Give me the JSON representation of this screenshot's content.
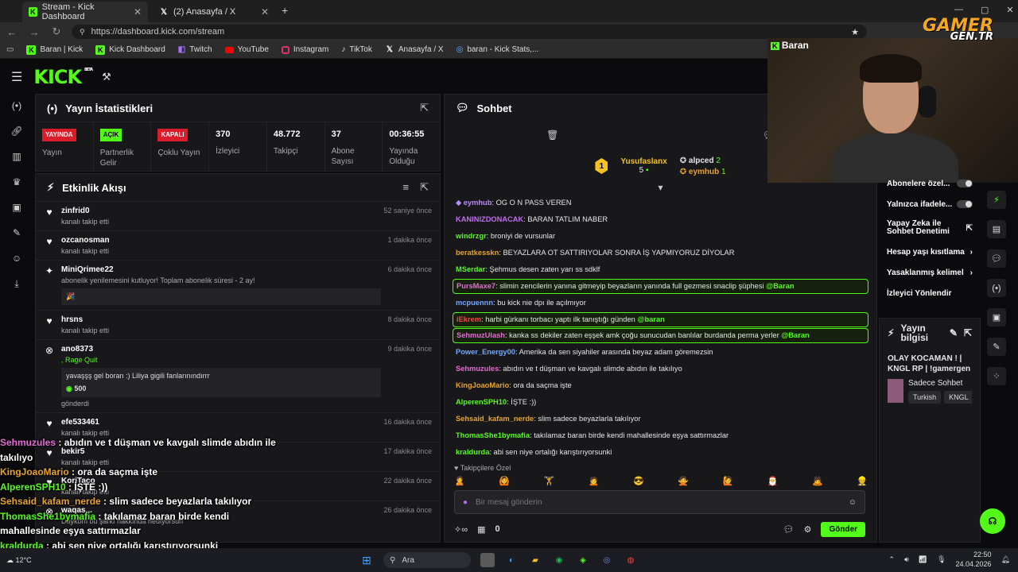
{
  "browser": {
    "tabs": [
      {
        "label": "Stream - Kick Dashboard",
        "icon": "kick-icon"
      },
      {
        "label": "(2) Anasayfa / X",
        "icon": "x-icon"
      }
    ],
    "url": "https://dashboard.kick.com/stream",
    "bookmarks": [
      {
        "label": "Baran | Kick",
        "icon": "kick"
      },
      {
        "label": "Kick Dashboard",
        "icon": "kick"
      },
      {
        "label": "Twitch",
        "icon": "twitch"
      },
      {
        "label": "YouTube",
        "icon": "youtube"
      },
      {
        "label": "Instagram",
        "icon": "instagram"
      },
      {
        "label": "TikTok",
        "icon": "tiktok"
      },
      {
        "label": "Anasayfa / X",
        "icon": "x"
      },
      {
        "label": "baran - Kick Stats,...",
        "icon": "stats"
      }
    ]
  },
  "header": {
    "logo": "KICK",
    "beta": "BETA"
  },
  "stats": {
    "title": "Yayın İstatistikleri",
    "items": [
      {
        "badge": "YAYINDA",
        "badge_color": "#d91b2a",
        "label": "Yayın"
      },
      {
        "badge": "AÇIK",
        "badge_color": "#53fc18",
        "label": "Partnerlik Gelir"
      },
      {
        "badge": "KAPALI",
        "badge_color": "#d91b2a",
        "label": "Çoklu Yayın"
      },
      {
        "value": "370",
        "label": "İzleyici"
      },
      {
        "value": "48.772",
        "label": "Takipçi"
      },
      {
        "value": "37",
        "label": "Abone Sayısı"
      },
      {
        "value": "00:36:55",
        "label": "Yayında Olduğu"
      }
    ]
  },
  "activity": {
    "title": "Etkinlik Akışı",
    "items": [
      {
        "name": "zinfrid0",
        "sub": "kanalı takip etti",
        "time": "52 saniye önce"
      },
      {
        "name": "ozcanosman",
        "sub": "kanalı takip etti",
        "time": "1 dakika önce"
      },
      {
        "name": "MiniQrimee22",
        "sub": "abonelik yenilemesini kutluyor! Toplam abonelik süresi - 2 ay!",
        "time": "6 dakika önce"
      },
      {
        "name": "hrsns",
        "sub": "kanalı takip etti",
        "time": "8 dakika önce"
      },
      {
        "name": "ano8373",
        "sub": ", Rage Quit",
        "message": "yavaşşş gel boran :) Liliya gigili fanlarınındırrr",
        "amount": "500",
        "sent": "gönderdi",
        "time": "9 dakika önce"
      },
      {
        "name": "efe533461",
        "sub": "kanalı takip etti",
        "time": "16 dakika önce"
      },
      {
        "name": "bekir5",
        "sub": "kanalı takip etti",
        "time": "17 dakika önce"
      },
      {
        "name": "KoriTaco",
        "sub": "kanalı takip etti",
        "time": "22 dakika önce"
      },
      {
        "name": "waqas...",
        "sub": "Daykom bu şarkı hakkında nediyorsun",
        "time": "26 dakika önce"
      }
    ]
  },
  "chat": {
    "title": "Sohbet",
    "leader": {
      "first": "Yusufaslanx",
      "first_count": "5",
      "second": "alpced",
      "second_count": "2",
      "third": "eymhub",
      "third_count": "1",
      "rank": "1"
    },
    "messages": [
      {
        "user": "eymhub",
        "color": "#b98cf7",
        "text": "OG O N PASS VEREN"
      },
      {
        "user": "KANINIZDONACAK",
        "color": "#c06cf0",
        "text": "BARAN TATLIM NABER"
      },
      {
        "user": "windrzgr",
        "color": "#53fc18",
        "text": "broniyi de vursunlar"
      },
      {
        "user": "beratkesskn",
        "color": "#e8a32d",
        "text": "BEYAZLARA OT SATTIRIYOLAR SONRA İŞ YAPMIYORUZ DİYOLAR"
      },
      {
        "user": "MSerdar",
        "color": "#53fc18",
        "text": "Şehmus desen zaten yarı ss sdklf"
      },
      {
        "user": "PursMaxe7",
        "color": "#e96ad8",
        "text": "slimin zencilerin yanına gitmeyip beyazların yanında full gezmesi snaclip şüphesi",
        "mention": "@Baran",
        "highlight": true
      },
      {
        "user": "mcpuennn",
        "color": "#6fa8ff",
        "text": "bu kick nie dpı ile açılmıyor"
      },
      {
        "user": "iEkrem",
        "color": "#ff4040",
        "text": "harbi gürkanı torbacı yaptı ilk tanıştığı günden",
        "mention": "@baran",
        "highlight": true
      },
      {
        "user": "SehmuzUlash",
        "color": "#e96ad8",
        "text": "kanka ss dekiler zaten eşşek amk çoğu sunucudan banlılar burdanda perma yerler",
        "mention": "@Baran",
        "highlight": true
      },
      {
        "user": "Power_Energy00",
        "color": "#6fa8ff",
        "text": "Amerika da sen siyahiler arasında beyaz adam göremezsin"
      },
      {
        "user": "Sehmuzules",
        "color": "#e96ad8",
        "text": "abıdın ve t düşman ve kavgalı slimde abıdın ile takılıyo"
      },
      {
        "user": "KingJoaoMario",
        "color": "#e8a32d",
        "text": "ora da saçma işte"
      },
      {
        "user": "AlperenSPH10",
        "color": "#53fc18",
        "text": "İŞTE :))"
      },
      {
        "user": "Sehsaid_kafam_nerde",
        "color": "#e8a32d",
        "text": "slim sadece beyazlarla takılıyor"
      },
      {
        "user": "ThomasShe1bymafia",
        "color": "#53fc18",
        "text": "takılamaz baran birde kendi mahallesinde eşya sattırmazlar"
      },
      {
        "user": "kraldurda",
        "color": "#53fc18",
        "text": "abi sen niye ortalığı karıştırıyorsunki"
      }
    ],
    "followers_only": "Takipçilere Özel",
    "input_placeholder": "Bir mesaj gönderin",
    "points": "0",
    "send": "Gönder"
  },
  "right": {
    "items": [
      {
        "label": "Abonelere özel...",
        "control": "toggle"
      },
      {
        "label": "Yalnızca ifadele...",
        "control": "toggle"
      },
      {
        "label": "Yapay Zeka ile Sohbet Denetimi",
        "control": "external"
      },
      {
        "label": "Hesap yaşı kısıtlama",
        "control": "chevron"
      },
      {
        "label": "Yasaklanmış kelimel",
        "control": "chevron"
      },
      {
        "label": "İzleyici Yönlendir",
        "control": "none"
      }
    ],
    "info_title": "Yayın bilgisi",
    "stream_title": "OLAY KOCAMAN ! | KNGL RP | !gamergen",
    "category": "Sadece Sohbet",
    "tags": [
      "Turkish",
      "KNGL"
    ]
  },
  "webcam": {
    "label": "Baran"
  },
  "watermark": {
    "line1": "GAMER",
    "line2": "GEN.TR"
  },
  "overlay": [
    {
      "user": "Sehmuzules",
      "color": "#e96ad8",
      "text": ": abıdın ve t düşman ve kavgalı slimde abıdın ile takılıyo"
    },
    {
      "user": "KingJoaoMario",
      "color": "#e8a32d",
      "text": ": ora da saçma işte"
    },
    {
      "user": "AlperenSPH10",
      "color": "#53fc18",
      "text": ": İŞTE :))"
    },
    {
      "user": "Sehsaid_kafam_nerde",
      "color": "#e8a32d",
      "text": ": slim sadece beyazlarla takılıyor"
    },
    {
      "user": "ThomasShe1bymafia",
      "color": "#53fc18",
      "text": ": takılamaz baran birde kendi mahallesinde eşya sattırmazlar"
    },
    {
      "user": "kraldurda",
      "color": "#53fc18",
      "text": ": abi sen niye ortalığı karıştırıyorsunki"
    }
  ],
  "taskbar": {
    "search": "Ara",
    "weather": "12°C",
    "time": "22:50",
    "date": "24.04.2026"
  }
}
